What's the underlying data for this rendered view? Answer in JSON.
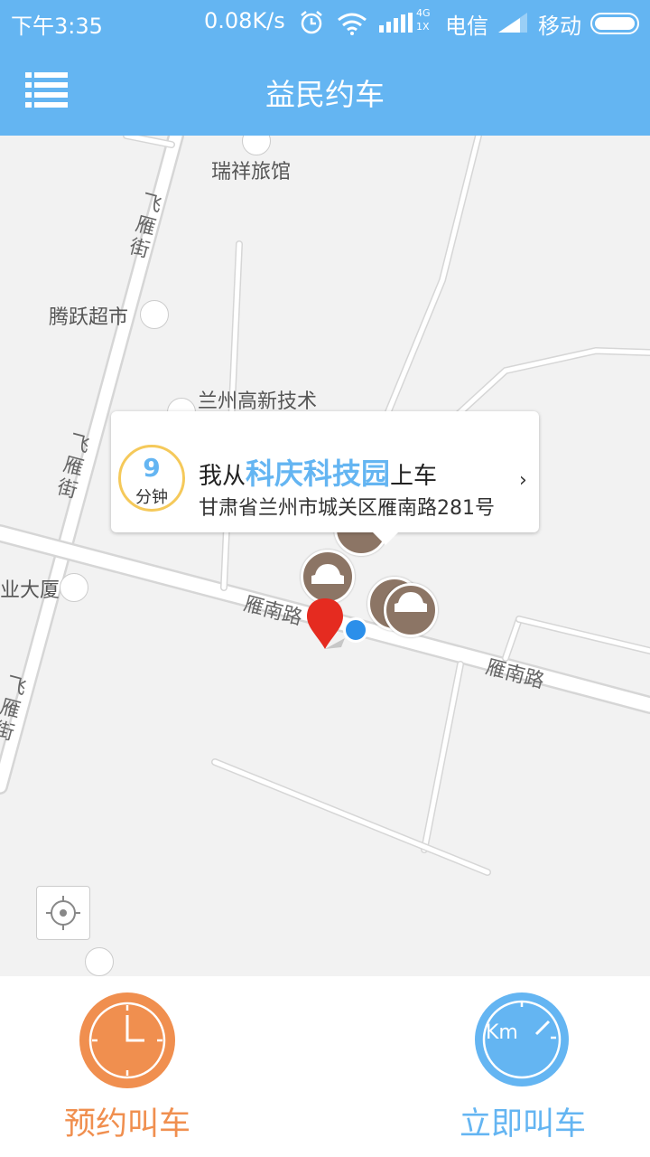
{
  "status_bar": {
    "time": "下午3:35",
    "network_speed": "0.08K/s",
    "network_type_top": "4G",
    "network_type_bottom": "1X",
    "carrier1": "电信",
    "carrier2": "移动"
  },
  "header": {
    "title": "益民约车"
  },
  "map": {
    "pois": {
      "ruixiang": "瑞祥旅馆",
      "tengyue": "腾跃超市",
      "lanzhou_hitech": "兰州高新技术",
      "building": "业大厦"
    },
    "roads": {
      "feiyan_top": "飞\n雁\n街",
      "feiyan_mid": "飞\n雁\n街",
      "feiyan_bottom": "飞\n雁\n街",
      "yannan_left": "雁南路",
      "yannan_right": "雁南路"
    },
    "pickup_bubble": {
      "eta_value": "9",
      "eta_unit": "分钟",
      "prefix": "我从",
      "place": "科庆科技园",
      "suffix": "上车",
      "address": "甘肃省兰州市城关区雁南路281号",
      "chevron": "›"
    }
  },
  "bottom_bar": {
    "reserve_label": "预约叫车",
    "instant_label": "立即叫车",
    "instant_icon_text": "Km",
    "reserve_color": "#f08f4f",
    "instant_color": "#64b5f2"
  },
  "colors": {
    "primary": "#64b5f2",
    "accent_orange": "#f08f4f",
    "eta_ring": "#f5c95a",
    "car_marker": "#8c7565",
    "pin_red": "#e52b20"
  }
}
